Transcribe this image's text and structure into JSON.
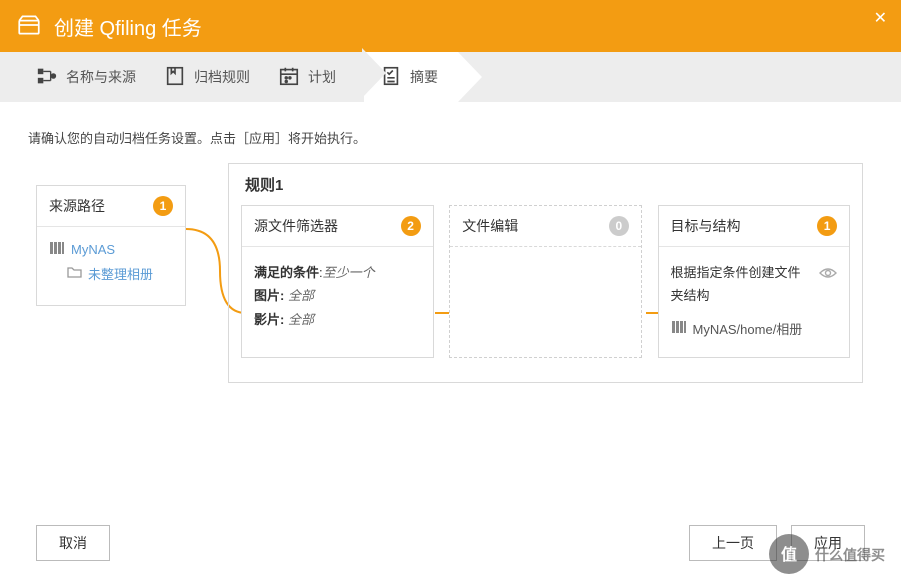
{
  "titlebar": {
    "title": "创建 Qfiling 任务"
  },
  "steps": {
    "s1": "名称与来源",
    "s2": "归档规则",
    "s3": "计划",
    "s4": "摘要"
  },
  "hint": "请确认您的自动归档任务设置。点击［应用］将开始执行。",
  "source": {
    "title": "来源路径",
    "badge": "1",
    "nas": "MyNAS",
    "folder": "未整理相册"
  },
  "rule": {
    "title": "规则1",
    "filter": {
      "title": "源文件筛选器",
      "badge": "2",
      "cond_label": "满足的条件",
      "cond_value": "至少一个",
      "row1_label": "图片:",
      "row1_value": "全部",
      "row2_label": "影片:",
      "row2_value": "全部"
    },
    "edit": {
      "title": "文件编辑",
      "badge": "0"
    },
    "dest": {
      "title": "目标与结构",
      "badge": "1",
      "desc": "根据指定条件创建文件夹结构",
      "path": "MyNAS/home/相册"
    }
  },
  "buttons": {
    "cancel": "取消",
    "prev": "上一页",
    "apply": "应用"
  },
  "watermark": "什么值得买"
}
